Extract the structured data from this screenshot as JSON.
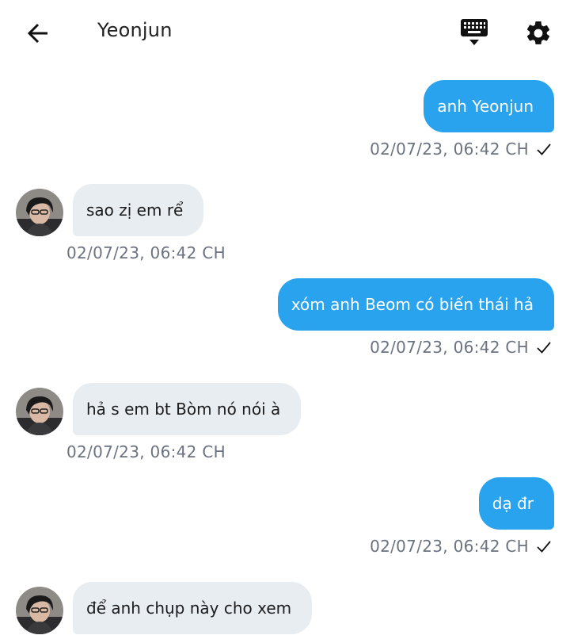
{
  "header": {
    "title": "Yeonjun",
    "back_icon": "arrow-left-icon",
    "keyboard_icon": "keyboard-icon",
    "settings_icon": "gear-icon"
  },
  "colors": {
    "outgoing_bubble": "#2aa3ef",
    "incoming_bubble": "#e8edf2",
    "timestamp": "#6b7280"
  },
  "messages": [
    {
      "direction": "out",
      "text": "anh Yeonjun",
      "time": "02/07/23,  06:42 CH",
      "status": "sent-check-icon"
    },
    {
      "direction": "in",
      "text": "sao zị em rể",
      "time": "02/07/23,  06:42 CH"
    },
    {
      "direction": "out",
      "text": "xóm anh Beom có biến thái hả",
      "time": "02/07/23,  06:42 CH",
      "status": "sent-check-icon"
    },
    {
      "direction": "in",
      "text": "hả s em bt Bòm nó nói à",
      "time": "02/07/23,  06:42 CH"
    },
    {
      "direction": "out",
      "text": "dạ đr",
      "time": "02/07/23,  06:42 CH",
      "status": "sent-check-icon"
    },
    {
      "direction": "in",
      "text": "để anh chụp này cho xem",
      "time": ""
    }
  ]
}
